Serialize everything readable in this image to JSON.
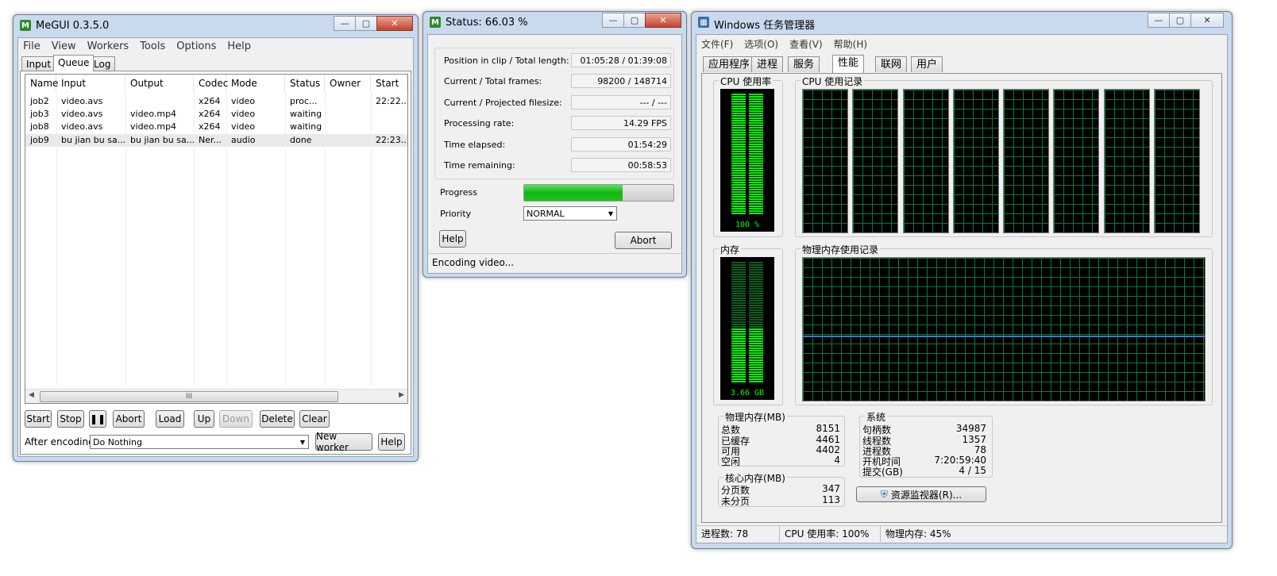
{
  "megui": {
    "title": "MeGUI 0.3.5.0",
    "menu": [
      "File",
      "View",
      "Workers",
      "Tools",
      "Options",
      "Help"
    ],
    "tabs": [
      "Input",
      "Queue",
      "Log"
    ],
    "columns": [
      "Name",
      "Input",
      "Output",
      "Codec",
      "Mode",
      "Status",
      "Owner",
      "Start"
    ],
    "rows": [
      {
        "name": "job2",
        "input": "video.avs",
        "output": "",
        "codec": "x264",
        "mode": "video",
        "status": "proc...",
        "owner": "",
        "start": "22:22..."
      },
      {
        "name": "job3",
        "input": "video.avs",
        "output": "video.mp4",
        "codec": "x264",
        "mode": "video",
        "status": "waiting",
        "owner": "",
        "start": ""
      },
      {
        "name": "job8",
        "input": "video.avs",
        "output": "video.mp4",
        "codec": "x264",
        "mode": "video",
        "status": "waiting",
        "owner": "",
        "start": ""
      },
      {
        "name": "job9",
        "input": "bu jian bu sa...",
        "output": "bu jian bu sa...",
        "codec": "Ner...",
        "mode": "audio",
        "status": "done",
        "owner": "",
        "start": "22:23..."
      }
    ],
    "buttons": {
      "start": "Start",
      "stop": "Stop",
      "abort": "Abort",
      "load": "Load",
      "up": "Up",
      "down": "Down",
      "delete": "Delete",
      "clear": "Clear"
    },
    "after_encoding_label": "After encoding:",
    "after_encoding_value": "Do Nothing",
    "new_worker": "New worker",
    "help": "Help"
  },
  "status": {
    "title": "Status: 66.03 %",
    "fields": [
      {
        "label": "Position in clip / Total length:",
        "value": "01:05:28 / 01:39:08"
      },
      {
        "label": "Current / Total frames:",
        "value": "98200 / 148714"
      },
      {
        "label": "Current / Projected filesize:",
        "value": "--- / ---"
      },
      {
        "label": "Processing rate:",
        "value": "14.29 FPS"
      },
      {
        "label": "Time elapsed:",
        "value": "01:54:29"
      },
      {
        "label": "Time remaining:",
        "value": "00:58:53"
      }
    ],
    "progress_label": "Progress",
    "progress_fraction": 0.6603,
    "priority_label": "Priority",
    "priority_value": "NORMAL",
    "help": "Help",
    "abort": "Abort",
    "status_text": "Encoding video..."
  },
  "taskmgr": {
    "title": "Windows 任务管理器",
    "menu": [
      "文件(F)",
      "选项(O)",
      "查看(V)",
      "帮助(H)"
    ],
    "tabs": [
      "应用程序",
      "进程",
      "服务",
      "性能",
      "联网",
      "用户"
    ],
    "cpu_usage_label": "CPU 使用率",
    "cpu_usage_value": "100 %",
    "cpu_usage_fraction": 1.0,
    "cpu_history_label": "CPU 使用记录",
    "mem_label": "内存",
    "mem_value": "3.66 GB",
    "mem_fraction": 0.45,
    "mem_history_label": "物理内存使用记录",
    "physical_mem": {
      "title": "物理内存(MB)",
      "rows": [
        {
          "k": "总数",
          "v": "8151"
        },
        {
          "k": "已缓存",
          "v": "4461"
        },
        {
          "k": "可用",
          "v": "4402"
        },
        {
          "k": "空闲",
          "v": "4"
        }
      ]
    },
    "kernel_mem": {
      "title": "核心内存(MB)",
      "rows": [
        {
          "k": "分页数",
          "v": "347"
        },
        {
          "k": "未分页",
          "v": "113"
        }
      ]
    },
    "system": {
      "title": "系统",
      "rows": [
        {
          "k": "句柄数",
          "v": "34987"
        },
        {
          "k": "线程数",
          "v": "1357"
        },
        {
          "k": "进程数",
          "v": "78"
        },
        {
          "k": "开机时间",
          "v": "7:20:59:40"
        },
        {
          "k": "提交(GB)",
          "v": "4 / 15"
        }
      ]
    },
    "resource_monitor": "资源监视器(R)...",
    "statusbar": [
      "进程数: 78",
      "CPU 使用率: 100%",
      "物理内存: 45%"
    ]
  },
  "colors": {
    "accent_green": "#00ff00",
    "progress_green": "#1ec21e",
    "graph_line": "#3a7bd5"
  }
}
